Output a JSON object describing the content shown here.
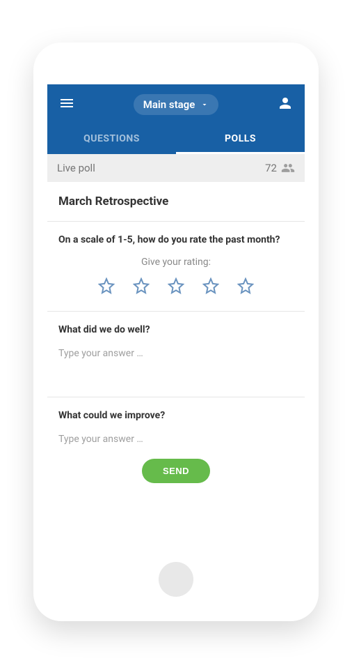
{
  "header": {
    "stage_label": "Main stage"
  },
  "tabs": {
    "questions": "QUESTIONS",
    "polls": "POLLS"
  },
  "live_bar": {
    "label": "Live poll",
    "count": "72"
  },
  "poll": {
    "title": "March Retrospective",
    "q1": {
      "text": "On a scale of 1-5, how do you rate the past month?",
      "rating_label": "Give your rating:"
    },
    "q2": {
      "text": "What did we do well?",
      "placeholder": "Type your answer …"
    },
    "q3": {
      "text": "What could we improve?",
      "placeholder": "Type your answer …"
    },
    "send_label": "SEND"
  }
}
